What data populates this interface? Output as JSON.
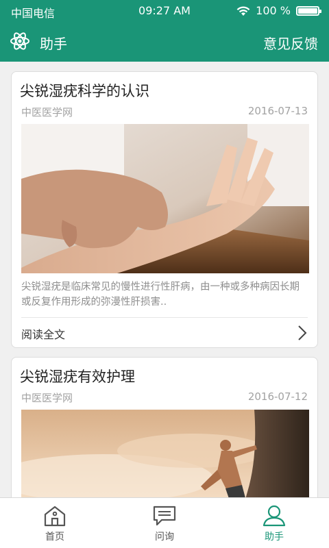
{
  "status_bar": {
    "carrier": "中国电信",
    "time": "09:27 AM",
    "battery_text": "100 %",
    "battery_level": 1.0
  },
  "header": {
    "title": "助手",
    "feedback_label": "意见反馈",
    "logo_icon": "atom-icon"
  },
  "articles": [
    {
      "title": "尖锐湿疣科学的认识",
      "source": "中医医学网",
      "date": "2016-07-13",
      "summary": "尖锐湿疣是临床常见的慢性进行性肝病，由一种或多种病因长期或反复作用形成的弥漫性肝损害..",
      "read_more": "阅读全文",
      "image": "pulse-diagnosis-photo"
    },
    {
      "title": "尖锐湿疣有效护理",
      "source": "中医医学网",
      "date": "2016-07-12",
      "image": "rock-climber-photo"
    }
  ],
  "tab_bar": {
    "items": [
      {
        "label": "首页",
        "icon": "home-icon",
        "active": false
      },
      {
        "label": "问询",
        "icon": "chat-icon",
        "active": false
      },
      {
        "label": "助手",
        "icon": "user-icon",
        "active": true
      }
    ]
  },
  "colors": {
    "brand": "#1a9577",
    "background": "#f0f0f0"
  }
}
